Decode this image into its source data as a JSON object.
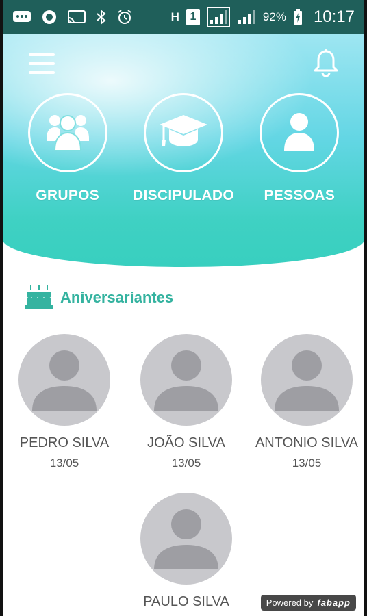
{
  "status_bar": {
    "signal_badge": "H",
    "sim_badge": "1",
    "battery": "92%",
    "time": "10:17"
  },
  "header": {
    "menu_icon": "hamburger-menu-icon",
    "notification_icon": "bell-icon",
    "nav": [
      {
        "label": "GRUPOS",
        "icon": "group-icon"
      },
      {
        "label": "DISCIPULADO",
        "icon": "graduation-cap-icon"
      },
      {
        "label": "PESSOAS",
        "icon": "person-icon"
      }
    ]
  },
  "birthdays": {
    "title": "Aniversariantes",
    "icon": "birthday-cake-icon",
    "people": [
      {
        "name": "PEDRO SILVA",
        "date": "13/05"
      },
      {
        "name": "JOÃO SILVA",
        "date": "13/05"
      },
      {
        "name": "ANTONIO SILVA",
        "date": "13/05"
      },
      {
        "name": "PAULO SILVA",
        "date": ""
      }
    ]
  },
  "watermark": {
    "prefix": "Powered by",
    "brand": "fabapp"
  },
  "colors": {
    "status_bar": "#1f5f5a",
    "accent": "#35b3a0",
    "hero_top": "#9ee6f2",
    "hero_bottom": "#38cfbf",
    "avatar_bg": "#c8c8cc"
  }
}
